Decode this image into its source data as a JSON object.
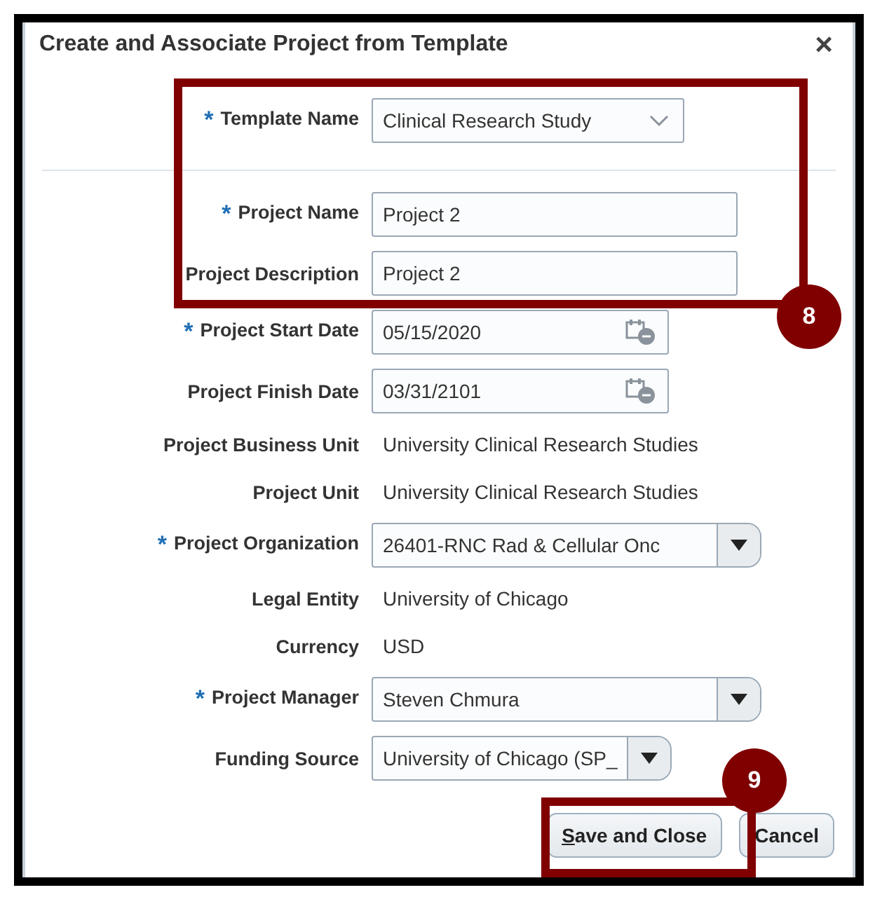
{
  "dialog": {
    "title": "Create and Associate Project from Template",
    "close": "×"
  },
  "header_fields": [
    {
      "label": "Template Name",
      "kind": "choice",
      "value": "Clinical Research Study",
      "required_mark": "*"
    }
  ],
  "fields": [
    {
      "label": "Project Name",
      "kind": "text",
      "value": "Project 2",
      "required_mark": "*"
    },
    {
      "label": "Project Description",
      "kind": "text",
      "value": "Project 2"
    },
    {
      "label": "Project Start Date",
      "kind": "date",
      "value": "05/15/2020",
      "required_mark": "*"
    },
    {
      "label": "Project Finish Date",
      "kind": "date",
      "value": "03/31/2101"
    },
    {
      "label": "Project Business Unit",
      "kind": "value",
      "value": "University Clinical Research Studies"
    },
    {
      "label": "Project Unit",
      "kind": "value",
      "value": "University Clinical Research Studies"
    },
    {
      "label": "Project Organization",
      "kind": "combo",
      "value": "26401-RNC Rad & Cellular Onc",
      "required_mark": "*"
    },
    {
      "label": "Legal Entity",
      "kind": "value",
      "value": "University of Chicago"
    },
    {
      "label": "Currency",
      "kind": "value",
      "value": "USD"
    },
    {
      "label": "Project Manager",
      "kind": "combo",
      "value": "Steven Chmura",
      "required_mark": "*"
    },
    {
      "label": "Funding Source",
      "kind": "combo_short",
      "value": "University of Chicago (SP_"
    }
  ],
  "buttons": [
    {
      "parts": [
        {
          "text": "S",
          "underlined": true
        },
        {
          "text": "ave and Close",
          "underlined": false
        }
      ]
    },
    {
      "parts": [
        {
          "text": "Cancel",
          "underlined": false
        }
      ]
    }
  ],
  "callouts": [
    {
      "label": "8"
    },
    {
      "label": "9"
    }
  ]
}
